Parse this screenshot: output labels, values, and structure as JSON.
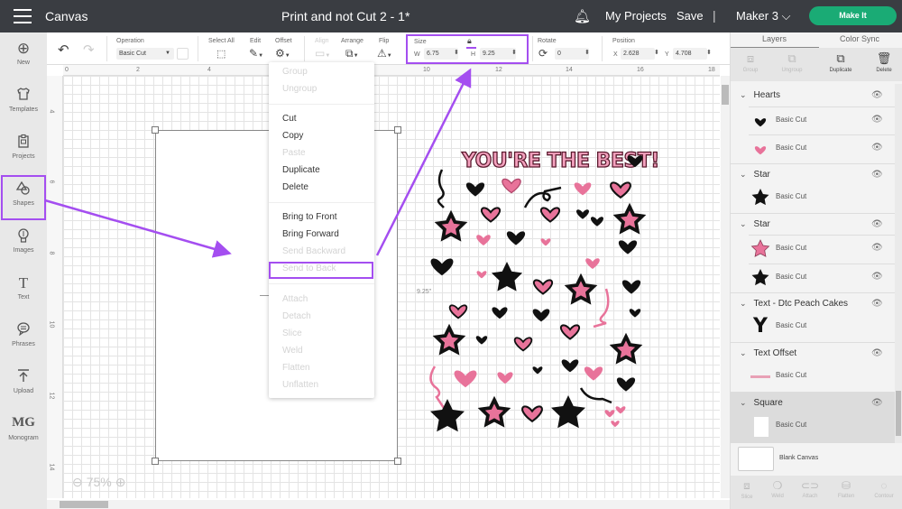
{
  "topbar": {
    "app_title": "Canvas",
    "doc_title": "Print and not Cut 2 - 1*",
    "bell_icon": "bell-icon",
    "my_projects": "My Projects",
    "save": "Save",
    "separator": "|",
    "machine": "Maker 3 ⌵",
    "make_it": "Make It",
    "make_it_color": "#1aab75"
  },
  "sidebar": {
    "items": [
      {
        "label": "New",
        "icon": "⊕"
      },
      {
        "label": "Templates",
        "icon": "👕"
      },
      {
        "label": "Projects",
        "icon": "▣"
      },
      {
        "label": "Shapes",
        "icon": "△"
      },
      {
        "label": "Images",
        "icon": "♁"
      },
      {
        "label": "Text",
        "icon": "T"
      },
      {
        "label": "Phrases",
        "icon": "☰"
      },
      {
        "label": "Upload",
        "icon": "⤒"
      },
      {
        "label": "Monogram",
        "icon": "M"
      }
    ],
    "active": "Shapes"
  },
  "toolbar": {
    "undo": "↶",
    "redo": "↷",
    "operation_label": "Operation",
    "operation_value": "Basic Cut",
    "select_all": "Select All",
    "edit": "Edit",
    "offset": "Offset",
    "align": "Align",
    "arrange": "Arrange",
    "flip": "Flip",
    "size_label": "Size",
    "w_label": "W",
    "w_value": "6.75",
    "h_label": "H",
    "h_value": "9.25",
    "rotate_label": "Rotate",
    "rotate_value": "0",
    "position_label": "Position",
    "x_label": "X",
    "x_value": "2.628",
    "y_label": "Y",
    "y_value": "4.708"
  },
  "canvas": {
    "ruler_h": [
      "0",
      "2",
      "4",
      "6",
      "8",
      "10",
      "12",
      "14",
      "16",
      "18"
    ],
    "ruler_v": [
      "4",
      "6",
      "8",
      "10",
      "12",
      "14"
    ],
    "zoom_level": "75%",
    "height_dim": "9.25\"",
    "design_title": "YOU'RE THE BEST!"
  },
  "context_menu": {
    "items": [
      {
        "label": "Group",
        "enabled": false
      },
      {
        "label": "Ungroup",
        "enabled": false
      },
      {
        "label": "Cut",
        "enabled": true
      },
      {
        "label": "Copy",
        "enabled": true
      },
      {
        "label": "Paste",
        "enabled": false
      },
      {
        "label": "Duplicate",
        "enabled": true
      },
      {
        "label": "Delete",
        "enabled": true
      },
      {
        "label": "Bring to Front",
        "enabled": true
      },
      {
        "label": "Bring Forward",
        "enabled": true
      },
      {
        "label": "Send Backward",
        "enabled": false
      },
      {
        "label": "Send to Back",
        "enabled": false
      },
      {
        "label": "Attach",
        "enabled": false
      },
      {
        "label": "Detach",
        "enabled": false
      },
      {
        "label": "Slice",
        "enabled": false
      },
      {
        "label": "Weld",
        "enabled": false
      },
      {
        "label": "Flatten",
        "enabled": false
      },
      {
        "label": "Unflatten",
        "enabled": false
      }
    ]
  },
  "right_panel": {
    "tabs": [
      "Layers",
      "Color Sync"
    ],
    "actions": [
      {
        "label": "Group",
        "enabled": false
      },
      {
        "label": "Ungroup",
        "enabled": false
      },
      {
        "label": "Duplicate",
        "enabled": true
      },
      {
        "label": "Delete",
        "enabled": true
      }
    ],
    "layers": [
      {
        "name": "Hearts",
        "items": [
          {
            "label": "Basic Cut",
            "thumb": "black-heart"
          },
          {
            "label": "Basic Cut",
            "thumb": "pink-heart"
          }
        ]
      },
      {
        "name": "Star",
        "items": [
          {
            "label": "Basic Cut",
            "thumb": "black-star"
          }
        ]
      },
      {
        "name": "Star",
        "items": [
          {
            "label": "Basic Cut",
            "thumb": "pink-star"
          },
          {
            "label": "Basic Cut",
            "thumb": "black-star"
          }
        ]
      },
      {
        "name": "Text - Dtc Peach Cakes",
        "items": [
          {
            "label": "Basic Cut",
            "thumb": "y-letter"
          }
        ]
      },
      {
        "name": "Text Offset",
        "items": [
          {
            "label": "Basic Cut",
            "thumb": "pink-line"
          }
        ]
      },
      {
        "name": "Square",
        "items": [
          {
            "label": "Basic Cut",
            "thumb": "white-square"
          }
        ]
      }
    ],
    "blank_canvas": "Blank Canvas",
    "bottom_actions": [
      "Slice",
      "Weld",
      "Attach",
      "Flatten",
      "Contour"
    ]
  },
  "colors": {
    "highlight": "#a44ef0",
    "pink": "#e8739a",
    "black": "#111111"
  }
}
